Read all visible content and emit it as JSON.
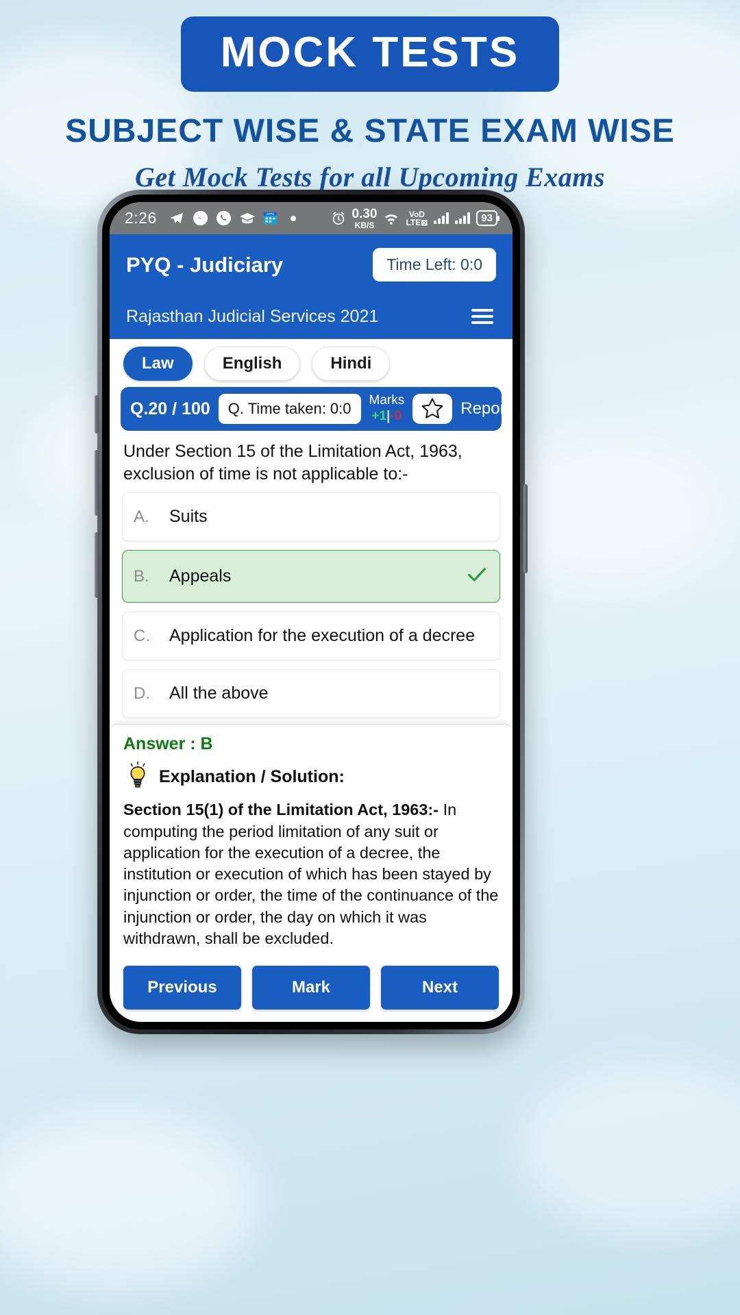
{
  "banner": {
    "title": "MOCK TESTS",
    "subtitle": "SUBJECT WISE & STATE EXAM WISE",
    "tagline": "Get Mock Tests for all Upcoming Exams",
    "accent_blue": "#1756b8"
  },
  "status_bar": {
    "time": "2:26",
    "left_icons": [
      "telegram-icon",
      "messenger-icon",
      "whatsapp-icon",
      "graduation-cap-icon",
      "calendar-icon",
      "dot-icon"
    ],
    "alarm_icon": "alarm-icon",
    "net_speed_value": "0.30",
    "net_speed_unit": "KB/S",
    "wifi_icon": "wifi-icon",
    "volte_line1": "VoD",
    "volte_line2": "LTE⊠",
    "signal_icon": "signal-bars-icon",
    "battery_level": "93"
  },
  "app_header": {
    "title": "PYQ - Judiciary",
    "time_left_label": "Time Left: 0:0",
    "exam_name": "Rajasthan Judicial Services 2021",
    "menu_icon": "hamburger-menu-icon",
    "bg_color": "#1a5dc0"
  },
  "subject_tabs": [
    {
      "label": "Law",
      "active": true
    },
    {
      "label": "English",
      "active": false
    },
    {
      "label": "Hindi",
      "active": false
    }
  ],
  "question_meta": {
    "question_number": "Q.20 / 100",
    "question_time": "Q. Time taken: 0:0",
    "marks_label": "Marks",
    "marks_positive": "+1",
    "marks_separator": "|",
    "marks_negative": "-0",
    "bookmark_icon": "star-icon",
    "report_label": "Report"
  },
  "question": {
    "text": "Under Section 15 of the Limitation Act, 1963, exclusion of time is not applicable to:-",
    "options": [
      {
        "letter": "A.",
        "text": "Suits",
        "correct": false
      },
      {
        "letter": "B.",
        "text": "Appeals",
        "correct": true
      },
      {
        "letter": "C.",
        "text": "Application for the execution of a decree",
        "correct": false
      },
      {
        "letter": "D.",
        "text": "All the above",
        "correct": false
      }
    ],
    "correct_tick_icon": "check-icon"
  },
  "answer": {
    "answer_line": "Answer : B",
    "bulb_icon": "lightbulb-icon",
    "explanation_title": "Explanation / Solution:",
    "explanation_bold": "Section 15(1) of the Limitation Act, 1963:-",
    "explanation_text": " In computing the period limitation of any suit or application for the execution of a decree, the institution or execution of which has been stayed by injunction or order, the time of the continuance of the injunction or order, the day on which it was withdrawn, shall be excluded."
  },
  "nav_buttons": [
    {
      "label": "Previous"
    },
    {
      "label": "Mark"
    },
    {
      "label": "Next"
    }
  ]
}
